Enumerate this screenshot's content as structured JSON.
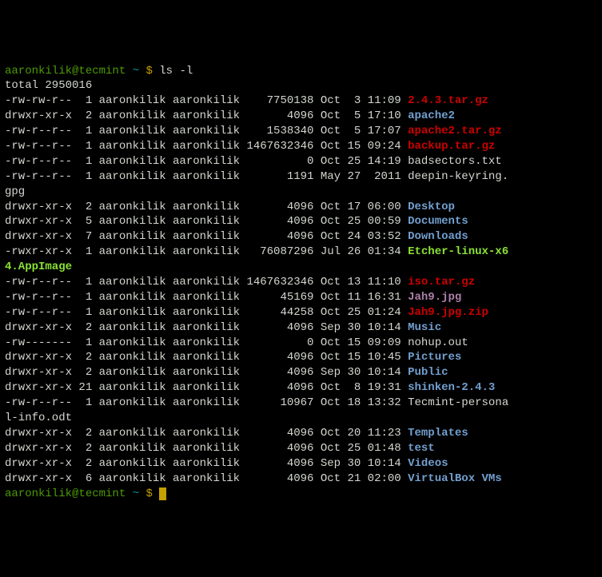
{
  "prompt": {
    "user_host": "aaronkilik@tecmint",
    "tilde": "~",
    "dollar": "$",
    "command": "ls -l"
  },
  "total_line": "total 2950016",
  "entries": [
    {
      "perm": "-rw-rw-r--",
      "links": "1",
      "owner": "aaronkilik",
      "group": "aaronkilik",
      "size": "7750138",
      "month": "Oct",
      "day": "3",
      "time": "11:09",
      "name": "2.4.3.tar.gz",
      "color": "red"
    },
    {
      "perm": "drwxr-xr-x",
      "links": "2",
      "owner": "aaronkilik",
      "group": "aaronkilik",
      "size": "4096",
      "month": "Oct",
      "day": "5",
      "time": "17:10",
      "name": "apache2",
      "color": "blue"
    },
    {
      "perm": "-rw-r--r--",
      "links": "1",
      "owner": "aaronkilik",
      "group": "aaronkilik",
      "size": "1538340",
      "month": "Oct",
      "day": "5",
      "time": "17:07",
      "name": "apache2.tar.gz",
      "color": "red"
    },
    {
      "perm": "-rw-r--r--",
      "links": "1",
      "owner": "aaronkilik",
      "group": "aaronkilik",
      "size": "1467632346",
      "month": "Oct",
      "day": "15",
      "time": "09:24",
      "name": "backup.tar.gz",
      "color": "red"
    },
    {
      "perm": "-rw-r--r--",
      "links": "1",
      "owner": "aaronkilik",
      "group": "aaronkilik",
      "size": "0",
      "month": "Oct",
      "day": "25",
      "time": "14:19",
      "name": "badsectors.txt",
      "color": "white"
    },
    {
      "perm": "-rw-r--r--",
      "links": "1",
      "owner": "aaronkilik",
      "group": "aaronkilik",
      "size": "1191",
      "month": "May",
      "day": "27",
      "time": "2011",
      "name": "deepin-keyring.",
      "wrap": "gpg",
      "color": "white"
    },
    {
      "perm": "drwxr-xr-x",
      "links": "2",
      "owner": "aaronkilik",
      "group": "aaronkilik",
      "size": "4096",
      "month": "Oct",
      "day": "17",
      "time": "06:00",
      "name": "Desktop",
      "color": "blue"
    },
    {
      "perm": "drwxr-xr-x",
      "links": "5",
      "owner": "aaronkilik",
      "group": "aaronkilik",
      "size": "4096",
      "month": "Oct",
      "day": "25",
      "time": "00:59",
      "name": "Documents",
      "color": "blue"
    },
    {
      "perm": "drwxr-xr-x",
      "links": "7",
      "owner": "aaronkilik",
      "group": "aaronkilik",
      "size": "4096",
      "month": "Oct",
      "day": "24",
      "time": "03:52",
      "name": "Downloads",
      "color": "blue"
    },
    {
      "perm": "-rwxr-xr-x",
      "links": "1",
      "owner": "aaronkilik",
      "group": "aaronkilik",
      "size": "76087296",
      "month": "Jul",
      "day": "26",
      "time": "01:34",
      "name": "Etcher-linux-x6",
      "wrap": "4.AppImage",
      "color": "bgreen"
    },
    {
      "perm": "-rw-r--r--",
      "links": "1",
      "owner": "aaronkilik",
      "group": "aaronkilik",
      "size": "1467632346",
      "month": "Oct",
      "day": "13",
      "time": "11:10",
      "name": "iso.tar.gz",
      "color": "red"
    },
    {
      "perm": "-rw-r--r--",
      "links": "1",
      "owner": "aaronkilik",
      "group": "aaronkilik",
      "size": "45169",
      "month": "Oct",
      "day": "11",
      "time": "16:31",
      "name": "Jah9.jpg",
      "color": "magenta"
    },
    {
      "perm": "-rw-r--r--",
      "links": "1",
      "owner": "aaronkilik",
      "group": "aaronkilik",
      "size": "44258",
      "month": "Oct",
      "day": "25",
      "time": "01:24",
      "name": "Jah9.jpg.zip",
      "color": "red"
    },
    {
      "perm": "drwxr-xr-x",
      "links": "2",
      "owner": "aaronkilik",
      "group": "aaronkilik",
      "size": "4096",
      "month": "Sep",
      "day": "30",
      "time": "10:14",
      "name": "Music",
      "color": "blue"
    },
    {
      "perm": "-rw-------",
      "links": "1",
      "owner": "aaronkilik",
      "group": "aaronkilik",
      "size": "0",
      "month": "Oct",
      "day": "15",
      "time": "09:09",
      "name": "nohup.out",
      "color": "white"
    },
    {
      "perm": "drwxr-xr-x",
      "links": "2",
      "owner": "aaronkilik",
      "group": "aaronkilik",
      "size": "4096",
      "month": "Oct",
      "day": "15",
      "time": "10:45",
      "name": "Pictures",
      "color": "blue"
    },
    {
      "perm": "drwxr-xr-x",
      "links": "2",
      "owner": "aaronkilik",
      "group": "aaronkilik",
      "size": "4096",
      "month": "Sep",
      "day": "30",
      "time": "10:14",
      "name": "Public",
      "color": "blue"
    },
    {
      "perm": "drwxr-xr-x",
      "links": "21",
      "owner": "aaronkilik",
      "group": "aaronkilik",
      "size": "4096",
      "month": "Oct",
      "day": "8",
      "time": "19:31",
      "name": "shinken-2.4.3",
      "color": "blue"
    },
    {
      "perm": "-rw-r--r--",
      "links": "1",
      "owner": "aaronkilik",
      "group": "aaronkilik",
      "size": "10967",
      "month": "Oct",
      "day": "18",
      "time": "13:32",
      "name": "Tecmint-persona",
      "wrap": "l-info.odt",
      "color": "white"
    },
    {
      "perm": "drwxr-xr-x",
      "links": "2",
      "owner": "aaronkilik",
      "group": "aaronkilik",
      "size": "4096",
      "month": "Oct",
      "day": "20",
      "time": "11:23",
      "name": "Templates",
      "color": "blue"
    },
    {
      "perm": "drwxr-xr-x",
      "links": "2",
      "owner": "aaronkilik",
      "group": "aaronkilik",
      "size": "4096",
      "month": "Oct",
      "day": "25",
      "time": "01:48",
      "name": "test",
      "color": "blue"
    },
    {
      "perm": "drwxr-xr-x",
      "links": "2",
      "owner": "aaronkilik",
      "group": "aaronkilik",
      "size": "4096",
      "month": "Sep",
      "day": "30",
      "time": "10:14",
      "name": "Videos",
      "color": "blue"
    },
    {
      "perm": "drwxr-xr-x",
      "links": "6",
      "owner": "aaronkilik",
      "group": "aaronkilik",
      "size": "4096",
      "month": "Oct",
      "day": "21",
      "time": "02:00",
      "name": "VirtualBox VMs",
      "color": "blue"
    }
  ],
  "cursor": " "
}
